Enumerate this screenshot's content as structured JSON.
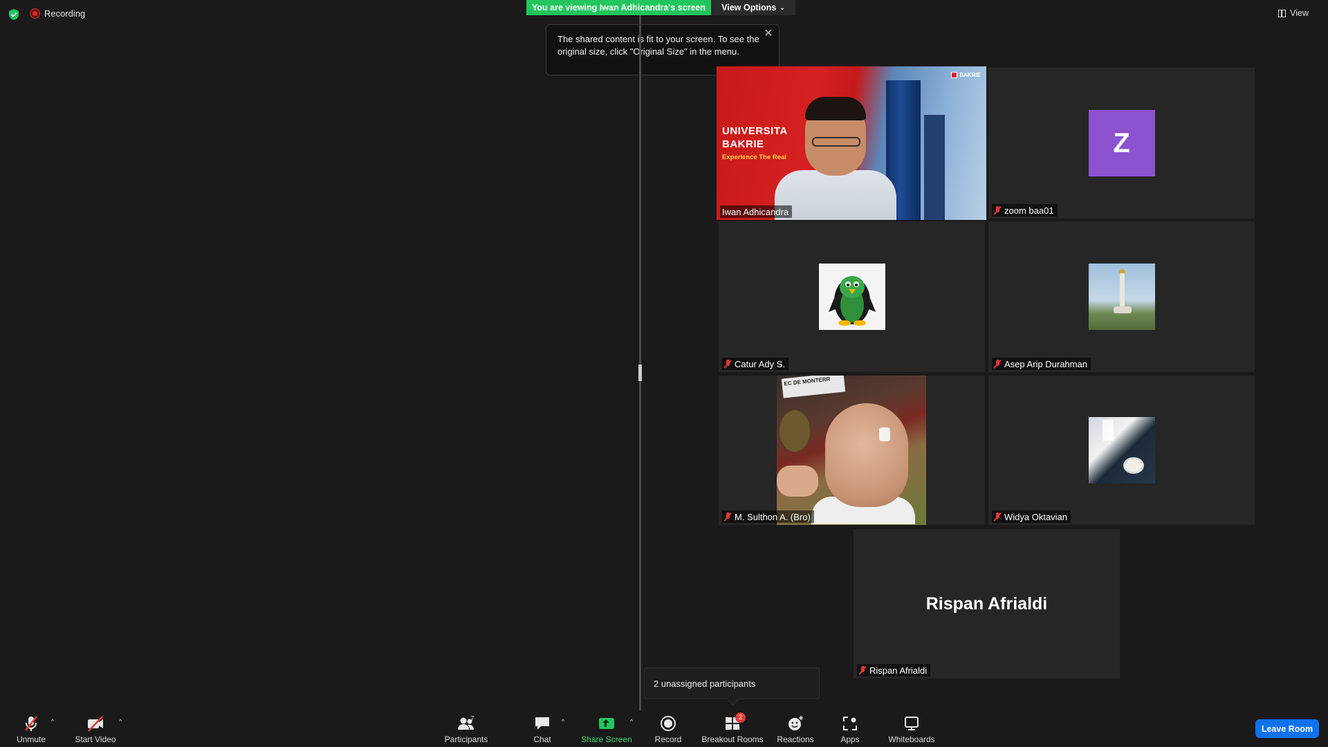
{
  "top": {
    "recording_label": "Recording",
    "viewing_banner": "You are viewing Iwan Adhicandra's screen",
    "view_options_label": "View Options",
    "view_label": "View",
    "tooltip_text": "The shared content is fit to your screen. To see the original size, click \"Original Size\" in the menu."
  },
  "participants": [
    {
      "name": "Iwan Adhicandra",
      "muted": false,
      "active_speaker": true,
      "video": true
    },
    {
      "name": "zoom baa01",
      "muted": true,
      "avatar_letter": "Z"
    },
    {
      "name": "Catur Ady S.",
      "muted": true
    },
    {
      "name": "Asep Arip Durahman",
      "muted": true
    },
    {
      "name": "M. Sulthon A. (Bro)",
      "muted": true
    },
    {
      "name": "Widya Oktavian",
      "muted": true
    },
    {
      "name": "Rispan Afrialdi",
      "muted": true,
      "display_name": "Rispan Afrialdi"
    }
  ],
  "shared_video": {
    "line1": "UNIVERSITA",
    "line2": "BAKRIE",
    "tagline": "Experience The Real",
    "logo": "BAKRIE"
  },
  "kid_sign": "EC DE MONTERR",
  "unassigned": "2 unassigned participants",
  "toolbar": {
    "unmute": "Unmute",
    "start_video": "Start Video",
    "participants": "Participants",
    "participants_count": "7",
    "chat": "Chat",
    "share_screen": "Share Screen",
    "record": "Record",
    "breakout_rooms": "Breakout Rooms",
    "breakout_badge": "2",
    "reactions": "Reactions",
    "apps": "Apps",
    "whiteboards": "Whiteboards",
    "leave_room": "Leave Room"
  },
  "colors": {
    "share_green": "#22c55e",
    "leave_blue": "#0e72ed",
    "active_speaker_border": "#f1e35a",
    "muted_red": "#e53935",
    "avatar_purple": "#8c52cf"
  }
}
